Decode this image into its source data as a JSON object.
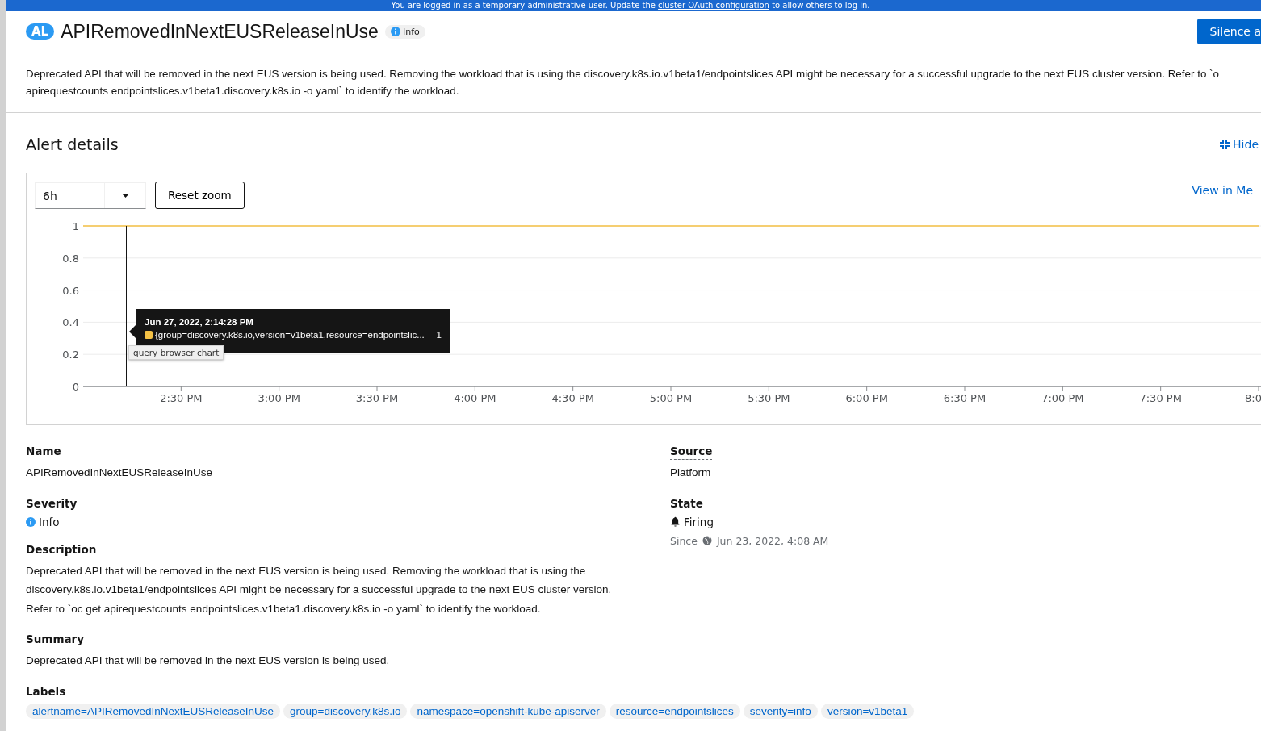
{
  "banner": {
    "text_before": "You are logged in as a temporary administrative user. Update the",
    "link": "cluster OAuth configuration",
    "text_after": "to allow others to log in."
  },
  "header": {
    "badge": "AL",
    "title": "APIRemovedInNextEUSReleaseInUse",
    "severity": "Info",
    "button": "Silence a"
  },
  "description_lines": [
    "Deprecated API that will be removed in the next EUS version is being used. Removing the workload that is using the discovery.k8s.io.v1beta1/endpointslices API might be necessary for a successful upgrade to the next EUS cluster version. Refer to `o",
    "apirequestcounts endpointslices.v1beta1.discovery.k8s.io -o yaml` to identify the workload."
  ],
  "alert_details": {
    "title": "Alert details",
    "hide": "Hide"
  },
  "chart_panel": {
    "time_range": "6h",
    "reset": "Reset zoom",
    "view_link": "View in Me",
    "chart_data": {
      "type": "line",
      "grid": true,
      "categories": [
        null,
        "2:30 PM",
        "3:00 PM",
        "3:30 PM",
        "4:00 PM",
        "4:30 PM",
        "5:00 PM",
        "5:30 PM",
        "6:00 PM",
        "6:30 PM",
        "7:00 PM",
        "7:30 PM",
        "8:0"
      ],
      "ylim": [
        0,
        1
      ],
      "yticks": [
        0,
        0.2,
        0.4,
        0.6,
        0.8,
        1
      ],
      "series": [
        {
          "name": "{group=discovery.k8s.io,version=v1beta1,resource=endpointslic...",
          "color": "#f4c145",
          "values": [
            1,
            1,
            1,
            1,
            1,
            1,
            1,
            1,
            1,
            1,
            1,
            1,
            1
          ]
        }
      ]
    },
    "tooltip": {
      "time": "Jun 27, 2022, 2:14:28 PM",
      "value": "1"
    },
    "browser_tooltip": "query browser chart"
  },
  "details_left": [
    {
      "kind": "text",
      "label": "Name",
      "help": false,
      "value": "APIRemovedInNextEUSReleaseInUse"
    },
    {
      "kind": "severity",
      "label": "Severity",
      "help": true,
      "value": "Info"
    },
    {
      "kind": "text",
      "label": "Description",
      "help": false,
      "value": "Deprecated API that will be removed in the next EUS version is being used. Removing the workload that is using the discovery.k8s.io.v1beta1/endpointslices API might be necessary for a successful upgrade to the next EUS cluster version. Refer to `oc get apirequestcounts endpointslices.v1beta1.discovery.k8s.io -o yaml` to identify the workload."
    },
    {
      "kind": "text",
      "label": "Summary",
      "help": false,
      "value": "Deprecated API that will be removed in the next EUS version is being used."
    },
    {
      "kind": "labels",
      "label": "Labels",
      "help": false,
      "values": [
        "alertname=APIRemovedInNextEUSReleaseInUse",
        "group=discovery.k8s.io",
        "namespace=openshift-kube-apiserver",
        "resource=endpointslices",
        "severity=info",
        "version=v1beta1"
      ]
    }
  ],
  "details_right": [
    {
      "kind": "text",
      "label": "Source",
      "help": true,
      "value": "Platform"
    },
    {
      "kind": "state",
      "label": "State",
      "help": true,
      "value": "Firing",
      "since_label": "Since",
      "since": "Jun 23, 2022, 4:08 AM"
    }
  ]
}
